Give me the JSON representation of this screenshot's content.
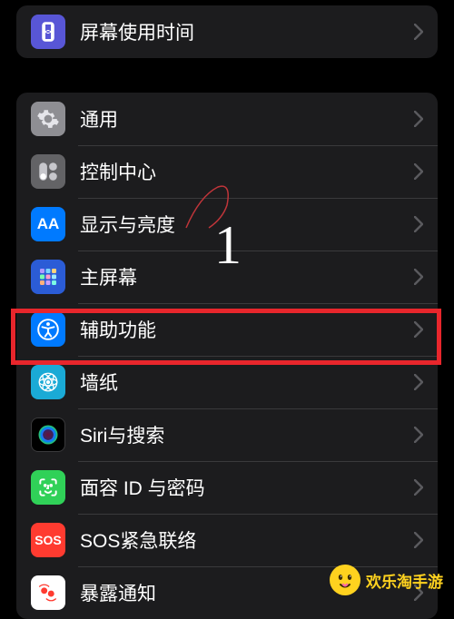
{
  "section1": {
    "items": [
      {
        "label": "屏幕使用时间"
      }
    ]
  },
  "section2": {
    "items": [
      {
        "label": "通用"
      },
      {
        "label": "控制中心"
      },
      {
        "label": "显示与亮度"
      },
      {
        "label": "主屏幕"
      },
      {
        "label": "辅助功能"
      },
      {
        "label": "墙纸"
      },
      {
        "label": "Siri与搜索"
      },
      {
        "label": "面容 ID 与密码"
      },
      {
        "label": "SOS紧急联络"
      },
      {
        "label": "暴露通知"
      }
    ]
  },
  "sos_text": "SOS",
  "annotation": {
    "number": "1"
  },
  "watermark": {
    "text": "欢乐淘手游"
  }
}
